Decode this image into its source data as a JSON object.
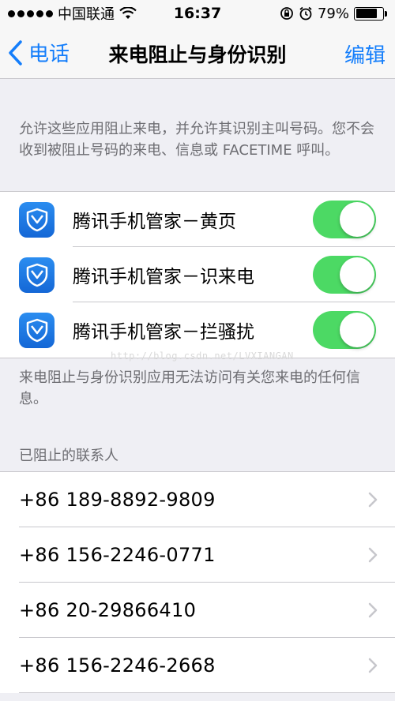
{
  "status_bar": {
    "carrier": "中国联通",
    "time": "16:37",
    "battery": "79%",
    "battery_level": 0.79
  },
  "nav": {
    "back_label": "电话",
    "title": "来电阻止与身份识别",
    "edit_label": "编辑"
  },
  "intro_text": "允许这些应用阻止来电，并允许其识别主叫号码。您不会收到被阻止号码的来电、信息或 FACETIME 呼叫。",
  "apps": [
    {
      "label": "腾讯手机管家－黄页",
      "enabled": true
    },
    {
      "label": "腾讯手机管家－识来电",
      "enabled": true
    },
    {
      "label": "腾讯手机管家－拦骚扰",
      "enabled": true
    }
  ],
  "watermark": "http://blog.csdn.net/LVXIANGAN",
  "apps_footer": "来电阻止与身份识别应用无法访问有关您来电的任何信息。",
  "blocked_header": "已阻止的联系人",
  "blocked_contacts": [
    "+86 189-8892-9809",
    "+86 156-2246-0771",
    "+86 20-29866410",
    "+86 156-2246-2668"
  ],
  "colors": {
    "accent": "#147efb",
    "toggle_on": "#4cd964",
    "app_icon": "#1a73e8"
  }
}
